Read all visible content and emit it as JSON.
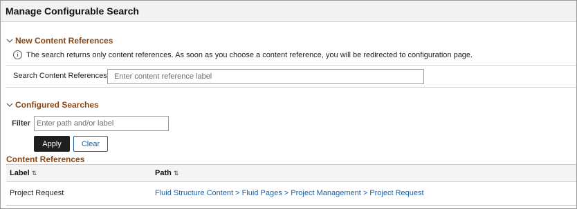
{
  "header": {
    "title": "Manage Configurable Search"
  },
  "new_content": {
    "section_title": "New Content References",
    "info_text": "The search returns only content references. As soon as you choose a content reference, you will be redirected to configuration page.",
    "search_label": "Search Content References",
    "search_placeholder": "Enter content reference label"
  },
  "configured": {
    "section_title": "Configured Searches",
    "filter_label": "Filter",
    "filter_placeholder": "Enter path and/or label",
    "apply_label": "Apply",
    "clear_label": "Clear"
  },
  "content_references": {
    "title": "Content References",
    "columns": [
      {
        "label": "Label",
        "sort_icon": "⇅"
      },
      {
        "label": "Path",
        "sort_icon": "⇅"
      }
    ],
    "rows": [
      {
        "label": "Project Request",
        "path": "Fluid Structure Content > Fluid Pages > Project Management > Project Request"
      }
    ]
  },
  "colors": {
    "section_title": "#8b4513",
    "link": "#1a5fa8",
    "apply_bg": "#1f1f1f"
  }
}
